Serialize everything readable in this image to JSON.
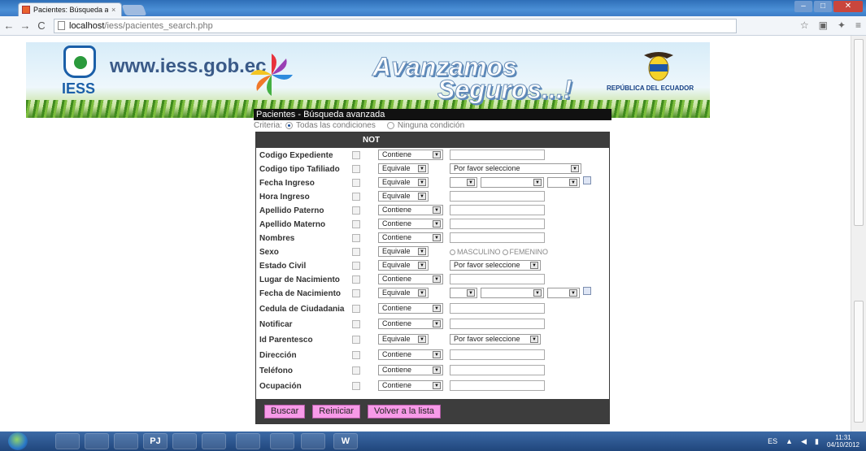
{
  "browser": {
    "tab_title": "Pacientes: Búsqueda avanz",
    "tab_close": "×",
    "url_host": "localhost",
    "url_path": "/iess/pacientes_search.php",
    "nav": {
      "back": "←",
      "forward": "→",
      "reload": "C"
    }
  },
  "banner": {
    "logo_text": "IESS",
    "site_url": "www.iess.gob.ec",
    "slogan_line1": "Avanzamos",
    "slogan_line2": "Seguros...!",
    "country": "REPÚBLICA DEL ECUADOR"
  },
  "form": {
    "title": "Pacientes - Búsqueda avanzada",
    "criteria_label": "Criteria:",
    "criteria_all": "Todas las condiciones",
    "criteria_none": "Ninguna condición",
    "not_header": "NOT",
    "please_select": "Por favor seleccione",
    "gender_male": "MASCULINO",
    "gender_female": "FEMENINO",
    "fields": [
      {
        "label": "Codigo Expediente",
        "op": "Contiene",
        "kind": "text"
      },
      {
        "label": "Codigo tipo Tafiliado",
        "op": "Equivale",
        "kind": "select"
      },
      {
        "label": "Fecha Ingreso",
        "op": "Equivale",
        "kind": "date"
      },
      {
        "label": "Hora Ingreso",
        "op": "Equivale",
        "kind": "text"
      },
      {
        "label": "Apellido Paterno",
        "op": "Contiene",
        "kind": "text"
      },
      {
        "label": "Apellido Materno",
        "op": "Contiene",
        "kind": "text"
      },
      {
        "label": "Nombres",
        "op": "Contiene",
        "kind": "text"
      },
      {
        "label": "Sexo",
        "op": "Equivale",
        "kind": "gender"
      },
      {
        "label": "Estado Civil",
        "op": "Equivale",
        "kind": "select-short"
      },
      {
        "label": "Lugar de Nacimiento",
        "op": "Contiene",
        "kind": "text"
      },
      {
        "label": "Fecha de Nacimiento",
        "op": "Equivale",
        "kind": "date"
      },
      {
        "label": "Cedula de Ciudadania",
        "op": "Contiene",
        "kind": "text"
      },
      {
        "label": "Notificar",
        "op": "Contiene",
        "kind": "text"
      },
      {
        "label": "Id Parentesco",
        "op": "Equivale",
        "kind": "select-short"
      },
      {
        "label": "Dirección",
        "op": "Contiene",
        "kind": "text"
      },
      {
        "label": "Teléfono",
        "op": "Contiene",
        "kind": "text"
      },
      {
        "label": "Ocupación",
        "op": "Contiene",
        "kind": "text"
      }
    ],
    "buttons": {
      "search": "Buscar",
      "reset": "Reiniciar",
      "back": "Volver a la lista"
    }
  },
  "taskbar": {
    "apps": [
      "",
      "",
      "",
      "PJ",
      "",
      "",
      "",
      "",
      "",
      "W"
    ],
    "lang": "ES",
    "time": "11:31",
    "date": "04/10/2012"
  },
  "colors": {
    "button_bg": "#f79ae8",
    "form_header": "#3d3d3d",
    "title_bar": "#111111"
  }
}
